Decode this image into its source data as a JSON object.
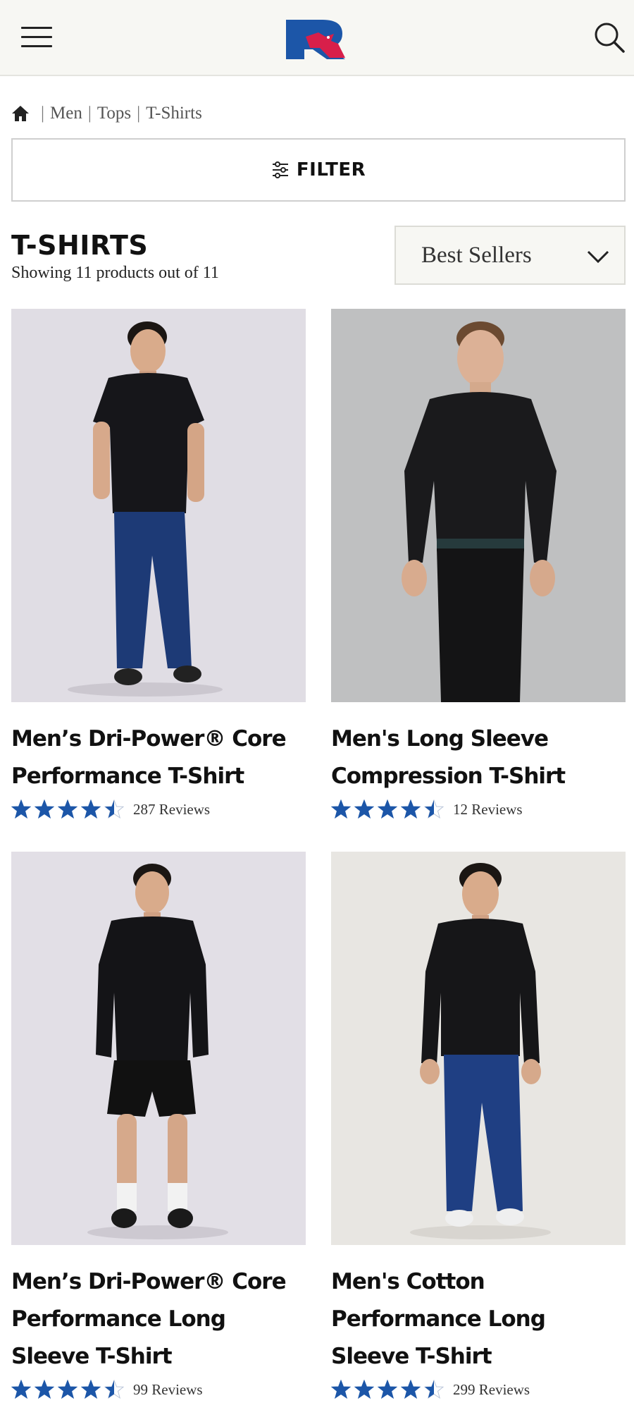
{
  "header": {
    "menu_icon": "hamburger-menu-icon",
    "logo": "russell-r-eagle-logo",
    "search_icon": "search-icon",
    "brand_colors": {
      "blue": "#1c56a8",
      "red": "#d81f4a"
    }
  },
  "breadcrumb": {
    "home_icon": "home-icon",
    "separator": "|",
    "items": [
      "Men",
      "Tops",
      "T-Shirts"
    ]
  },
  "filter": {
    "label": "FILTER",
    "icon": "sliders-icon"
  },
  "listing": {
    "title": "T-SHIRTS",
    "count_text": "Showing 11 products out of 11"
  },
  "sort": {
    "selected": "Best Sellers",
    "icon": "chevron-down-icon"
  },
  "star_color": "#1c56a8",
  "products": [
    {
      "name": "Men’s Dri-Power® Core Performance T-Shirt",
      "rating": 4.5,
      "reviews_text": "287 Reviews",
      "photo_bg": "#e0dde4"
    },
    {
      "name": "Men's Long Sleeve Compression T-Shirt",
      "rating": 4.5,
      "reviews_text": "12 Reviews",
      "photo_bg": "#bfc0c1"
    },
    {
      "name": "Men’s Dri-Power® Core Performance Long Sleeve T-Shirt",
      "rating": 4.5,
      "reviews_text": "99 Reviews",
      "photo_bg": "#e2dfe6"
    },
    {
      "name": "Men's Cotton Performance Long Sleeve T-Shirt",
      "rating": 4.5,
      "reviews_text": "299 Reviews",
      "photo_bg": "#e8e6e2"
    }
  ]
}
